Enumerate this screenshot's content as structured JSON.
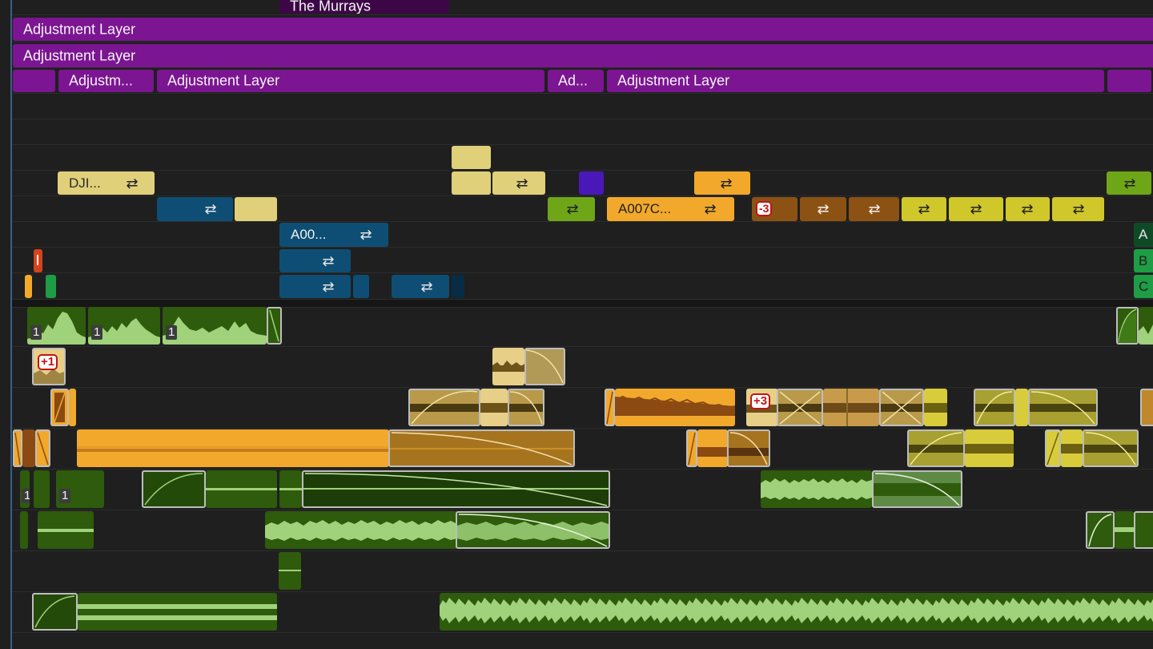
{
  "timeline": {
    "top_title_clip": "The Murrays",
    "adjustment_layer_label": "Adjustment Layer",
    "adjustment_short_1": "Adjustm...",
    "adjustment_short_2": "Ad...",
    "video_clip_dji": "DJI...",
    "video_clip_a007c": "A007C...",
    "video_clip_a00": "A00...",
    "edge_clip_a": "A",
    "edge_clip_b": "B",
    "edge_clip_c": "C",
    "badge_minus3": "-3",
    "badge_plus1": "+1",
    "badge_plus3": "+3",
    "channel_number": "1",
    "fx_icon_glyph": "⇄"
  },
  "colors": {
    "adjustment": "#7b1591",
    "title_clip": "#3d0747",
    "tan": "#e0d07a",
    "teal": "#0e4e74",
    "orange": "#f2a92b",
    "dark_orange": "#8c5214",
    "yellow": "#d0c72b",
    "lime_green": "#6ea618",
    "bright_green": "#1e9d46",
    "indigo": "#4a18b8",
    "audio_green_bg": "#2e5b0c",
    "audio_green_wave": "#9fd27a",
    "audio_orange_bg": "#f2a92b",
    "audio_orange_wave": "#8b4a12",
    "audio_tan_bg": "#e8cf88",
    "audio_tan_wave": "#6d5318",
    "audio_yellow_bg": "#d9cc3b",
    "audio_yellow_wave": "#6b6110"
  },
  "icons": [
    "fx-effect-icon",
    "track-target-icon"
  ]
}
